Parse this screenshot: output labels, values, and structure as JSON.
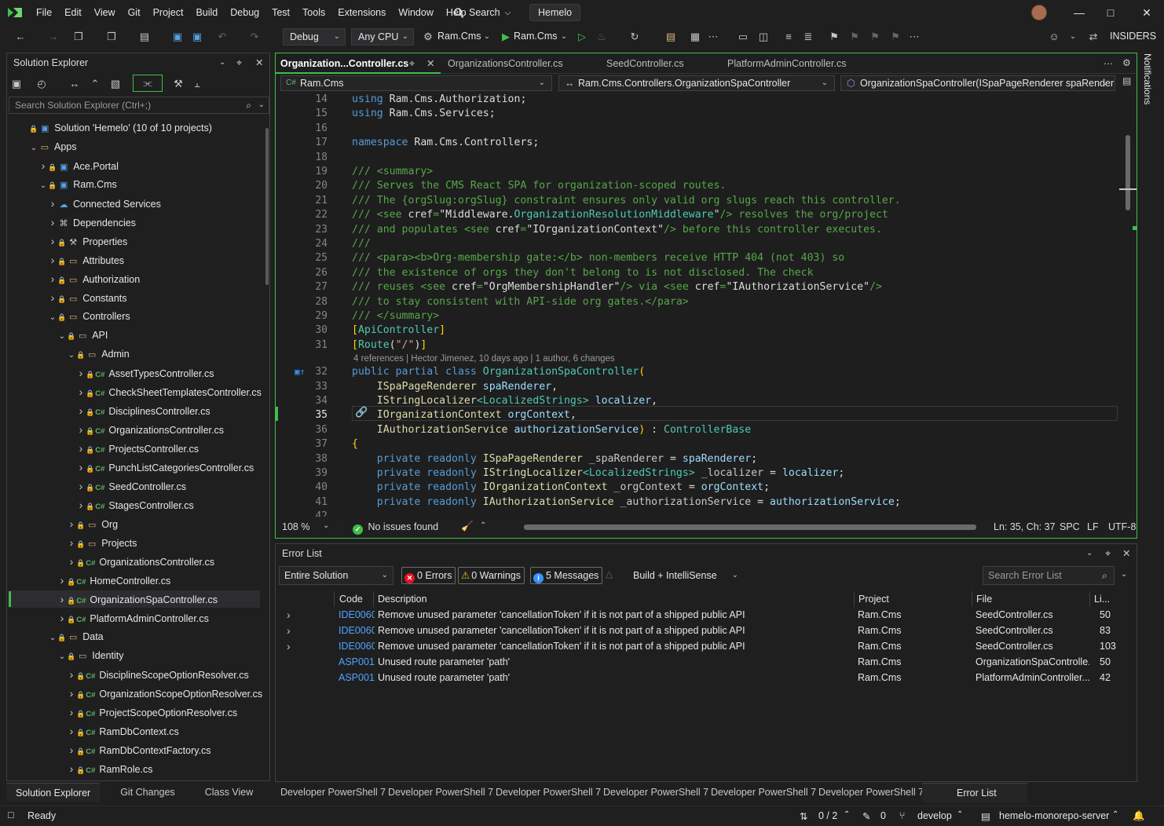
{
  "menu": [
    "File",
    "Edit",
    "View",
    "Git",
    "Project",
    "Build",
    "Debug",
    "Test",
    "Tools",
    "Extensions",
    "Window",
    "Help"
  ],
  "title": {
    "search": "Search",
    "project": "Hemelo"
  },
  "toolbar": {
    "config": "Debug",
    "platform": "Any CPU",
    "startup_project": "Ram.Cms",
    "run_target": "Ram.Cms",
    "insiders": "INSIDERS"
  },
  "solution_explorer": {
    "title": "Solution Explorer",
    "search_placeholder": "Search Solution Explorer (Ctrl+;)",
    "nodes": [
      {
        "label": "Solution 'Hemelo' (10 of 10 projects)",
        "depth": 0,
        "arrow": "",
        "icon": "solution"
      },
      {
        "label": "Apps",
        "depth": 1,
        "arrow": "open",
        "icon": "folder"
      },
      {
        "label": "Ace.Portal",
        "depth": 2,
        "arrow": "closed",
        "icon": "project"
      },
      {
        "label": "Ram.Cms",
        "depth": 2,
        "arrow": "open",
        "icon": "project"
      },
      {
        "label": "Connected Services",
        "depth": 3,
        "arrow": "closed",
        "icon": "services"
      },
      {
        "label": "Dependencies",
        "depth": 3,
        "arrow": "closed",
        "icon": "deps"
      },
      {
        "label": "Properties",
        "depth": 3,
        "arrow": "closed",
        "icon": "props"
      },
      {
        "label": "Attributes",
        "depth": 3,
        "arrow": "closed",
        "icon": "folder"
      },
      {
        "label": "Authorization",
        "depth": 3,
        "arrow": "closed",
        "icon": "folder"
      },
      {
        "label": "Constants",
        "depth": 3,
        "arrow": "closed",
        "icon": "folder"
      },
      {
        "label": "Controllers",
        "depth": 3,
        "arrow": "open",
        "icon": "folder"
      },
      {
        "label": "API",
        "depth": 4,
        "arrow": "open",
        "icon": "folder"
      },
      {
        "label": "Admin",
        "depth": 5,
        "arrow": "open",
        "icon": "folder"
      },
      {
        "label": "AssetTypesController.cs",
        "depth": 6,
        "arrow": "closed",
        "icon": "cs"
      },
      {
        "label": "CheckSheetTemplatesController.cs",
        "depth": 6,
        "arrow": "closed",
        "icon": "cs"
      },
      {
        "label": "DisciplinesController.cs",
        "depth": 6,
        "arrow": "closed",
        "icon": "cs"
      },
      {
        "label": "OrganizationsController.cs",
        "depth": 6,
        "arrow": "closed",
        "icon": "cs"
      },
      {
        "label": "ProjectsController.cs",
        "depth": 6,
        "arrow": "closed",
        "icon": "cs"
      },
      {
        "label": "PunchListCategoriesController.cs",
        "depth": 6,
        "arrow": "closed",
        "icon": "cs"
      },
      {
        "label": "SeedController.cs",
        "depth": 6,
        "arrow": "closed",
        "icon": "cs"
      },
      {
        "label": "StagesController.cs",
        "depth": 6,
        "arrow": "closed",
        "icon": "cs"
      },
      {
        "label": "Org",
        "depth": 5,
        "arrow": "closed",
        "icon": "folder"
      },
      {
        "label": "Projects",
        "depth": 5,
        "arrow": "closed",
        "icon": "folder"
      },
      {
        "label": "OrganizationsController.cs",
        "depth": 5,
        "arrow": "closed",
        "icon": "cs"
      },
      {
        "label": "HomeController.cs",
        "depth": 4,
        "arrow": "closed",
        "icon": "cs"
      },
      {
        "label": "OrganizationSpaController.cs",
        "depth": 4,
        "arrow": "closed",
        "icon": "cs",
        "selected": true
      },
      {
        "label": "PlatformAdminController.cs",
        "depth": 4,
        "arrow": "closed",
        "icon": "cs"
      },
      {
        "label": "Data",
        "depth": 3,
        "arrow": "open",
        "icon": "folder"
      },
      {
        "label": "Identity",
        "depth": 4,
        "arrow": "open",
        "icon": "folder"
      },
      {
        "label": "DisciplineScopeOptionResolver.cs",
        "depth": 5,
        "arrow": "closed",
        "icon": "cs"
      },
      {
        "label": "OrganizationScopeOptionResolver.cs",
        "depth": 5,
        "arrow": "closed",
        "icon": "cs"
      },
      {
        "label": "ProjectScopeOptionResolver.cs",
        "depth": 5,
        "arrow": "closed",
        "icon": "cs"
      },
      {
        "label": "RamDbContext.cs",
        "depth": 5,
        "arrow": "closed",
        "icon": "cs"
      },
      {
        "label": "RamDbContextFactory.cs",
        "depth": 5,
        "arrow": "closed",
        "icon": "cs"
      },
      {
        "label": "RamRole.cs",
        "depth": 5,
        "arrow": "closed",
        "icon": "cs"
      }
    ],
    "bottom_tabs": [
      "Solution Explorer",
      "Git Changes",
      "Class View"
    ]
  },
  "editor": {
    "tabs": [
      "Organization...Controller.cs",
      "OrganizationsController.cs",
      "SeedController.cs",
      "PlatformAdminController.cs"
    ],
    "nav": {
      "project": "Ram.Cms",
      "type": "Ram.Cms.Controllers.OrganizationSpaController",
      "member": "OrganizationSpaController(ISpaPageRenderer spaRender"
    },
    "codelens": "4 references | Hector Jimenez, 10 days ago | 1 author, 6 changes",
    "lines": [
      {
        "n": "14",
        "html": "<span class='k'>using</span> <span class='w'>Ram</span>.<span class='w'>Cms</span>.<span class='w'>Authorization</span>;"
      },
      {
        "n": "15",
        "html": "<span class='k'>using</span> <span class='w'>Ram</span>.<span class='w'>Cms</span>.<span class='w'>Services</span>;"
      },
      {
        "n": "16",
        "html": ""
      },
      {
        "n": "17",
        "html": "<span class='k'>namespace</span> <span class='w'>Ram</span>.<span class='w'>Cms</span>.<span class='w'>Controllers</span>;"
      },
      {
        "n": "18",
        "html": ""
      },
      {
        "n": "19",
        "html": "<span class='c'>/// &lt;summary&gt;</span>"
      },
      {
        "n": "20",
        "html": "<span class='c'>/// Serves the CMS React SPA for organization-scoped routes.</span>"
      },
      {
        "n": "21",
        "html": "<span class='c'>/// The {orgSlug:orgSlug} constraint ensures only valid org slugs reach this controller.</span>"
      },
      {
        "n": "22",
        "html": "<span class='c'>/// &lt;see </span><span class='w'>cref</span><span class='c'>=</span><span class='w'>\"Middleware</span>.<span class='t'>OrganizationResolutionMiddleware</span><span class='w'>\"</span><span class='c'>/&gt; resolves the org/project</span>"
      },
      {
        "n": "23",
        "html": "<span class='c'>/// and populates &lt;see </span><span class='w'>cref</span><span class='c'>=</span><span class='w'>\"IOrganizationContext\"</span><span class='c'>/&gt; before this controller executes.</span>"
      },
      {
        "n": "24",
        "html": "<span class='c'>///</span>"
      },
      {
        "n": "25",
        "html": "<span class='c'>/// &lt;para&gt;&lt;b&gt;Org-membership gate:&lt;/b&gt; non-members receive HTTP 404 (not 403) so</span>"
      },
      {
        "n": "26",
        "html": "<span class='c'>/// the existence of orgs they don't belong to is not disclosed. The check</span>"
      },
      {
        "n": "27",
        "html": "<span class='c'>/// reuses &lt;see </span><span class='w'>cref</span><span class='c'>=</span><span class='w'>\"OrgMembershipHandler\"</span><span class='c'>/&gt; via &lt;see </span><span class='w'>cref</span><span class='c'>=</span><span class='w'>\"IAuthorizationService\"</span><span class='c'>/&gt;</span>"
      },
      {
        "n": "28",
        "html": "<span class='c'>/// to stay consistent with API-side org gates.&lt;/para&gt;</span>"
      },
      {
        "n": "29",
        "html": "<span class='c'>/// &lt;/summary&gt;</span>"
      },
      {
        "n": "30",
        "html": "<span class='y'>[</span><span class='t'>ApiController</span><span class='y'>]</span>"
      },
      {
        "n": "31",
        "html": "<span class='y'>[</span><span class='t'>Route</span><span class='w'>(</span><span class='s'>\"/\"</span><span class='w'>)</span><span class='y'>]</span>"
      },
      {
        "n": "32",
        "html": "<span class='k'>public</span> <span class='k'>partial</span> <span class='k'>class</span> <span class='t'>OrganizationSpaController</span><span class='y'>(</span>"
      },
      {
        "n": "33",
        "html": "    <span class='a'>ISpaPageRenderer</span> <span class='g'>spaRenderer</span>,"
      },
      {
        "n": "34",
        "html": "    <span class='a'>IStringLocalizer</span><span class='t'>&lt;LocalizedStrings&gt;</span> <span class='g'>localizer</span>,"
      },
      {
        "n": "35",
        "html": "    <span class='a'>IOrganizationContext</span> <span class='g'>orgContext</span>,"
      },
      {
        "n": "36",
        "html": "    <span class='a'>IAuthorizationService</span> <span class='g'>authorizationService</span><span class='y'>)</span> : <span class='t'>ControllerBase</span>"
      },
      {
        "n": "37",
        "html": "<span class='y'>{</span>"
      },
      {
        "n": "38",
        "html": "    <span class='k'>private</span> <span class='k'>readonly</span> <span class='a'>ISpaPageRenderer</span> <span class='f'>_spaRenderer</span> = <span class='g'>spaRenderer</span>;"
      },
      {
        "n": "39",
        "html": "    <span class='k'>private</span> <span class='k'>readonly</span> <span class='a'>IStringLocalizer</span><span class='t'>&lt;LocalizedStrings&gt;</span> <span class='f'>_localizer</span> = <span class='g'>localizer</span>;"
      },
      {
        "n": "40",
        "html": "    <span class='k'>private</span> <span class='k'>readonly</span> <span class='a'>IOrganizationContext</span> <span class='f'>_orgContext</span> = <span class='g'>orgContext</span>;"
      },
      {
        "n": "41",
        "html": "    <span class='k'>private</span> <span class='k'>readonly</span> <span class='a'>IAuthorizationService</span> <span class='f'>_authorizationService</span> = <span class='g'>authorizationService</span>;"
      },
      {
        "n": "42",
        "html": ""
      }
    ],
    "status": {
      "zoom": "108 %",
      "issues": "No issues found",
      "position": "Ln: 35, Ch: 37",
      "whitespace": "SPC",
      "eol": "LF",
      "encoding": "UTF-8"
    }
  },
  "error_list": {
    "title": "Error List",
    "scope": "Entire Solution",
    "errors": "0 Errors",
    "warnings": "0 Warnings",
    "messages": "5 Messages",
    "source": "Build + IntelliSense",
    "search_placeholder": "Search Error List",
    "columns": [
      "Code",
      "Description",
      "Project",
      "File",
      "Li..."
    ],
    "rows": [
      {
        "expand": true,
        "code": "IDE0060",
        "desc": "Remove unused parameter 'cancellationToken' if it is not part of a shipped public API",
        "project": "Ram.Cms",
        "file": "SeedController.cs",
        "line": "50"
      },
      {
        "expand": true,
        "code": "IDE0060",
        "desc": "Remove unused parameter 'cancellationToken' if it is not part of a shipped public API",
        "project": "Ram.Cms",
        "file": "SeedController.cs",
        "line": "83"
      },
      {
        "expand": true,
        "code": "IDE0060",
        "desc": "Remove unused parameter 'cancellationToken' if it is not part of a shipped public API",
        "project": "Ram.Cms",
        "file": "SeedController.cs",
        "line": "103"
      },
      {
        "expand": false,
        "code": "ASP0018",
        "desc": "Unused route parameter 'path'",
        "project": "Ram.Cms",
        "file": "OrganizationSpaControlle...",
        "line": "50"
      },
      {
        "expand": false,
        "code": "ASP0018",
        "desc": "Unused route parameter 'path'",
        "project": "Ram.Cms",
        "file": "PlatformAdminController....",
        "line": "42"
      }
    ]
  },
  "bottom_tabs": [
    "Developer PowerShell 7",
    "Developer PowerShell 7",
    "Developer PowerShell 7",
    "Developer PowerShell 7",
    "Developer PowerShell 7",
    "Developer PowerShell 7",
    "Error List"
  ],
  "statusbar": {
    "ready": "Ready",
    "sync": "0 / 2",
    "edits": "0",
    "branch": "develop",
    "repo": "hemelo-monorepo-server"
  },
  "notifications": "Notifications",
  "colors": {
    "accent": "#3fbf4a",
    "info": "#3794ff",
    "error": "#e81123",
    "warning": "#f2c318"
  }
}
